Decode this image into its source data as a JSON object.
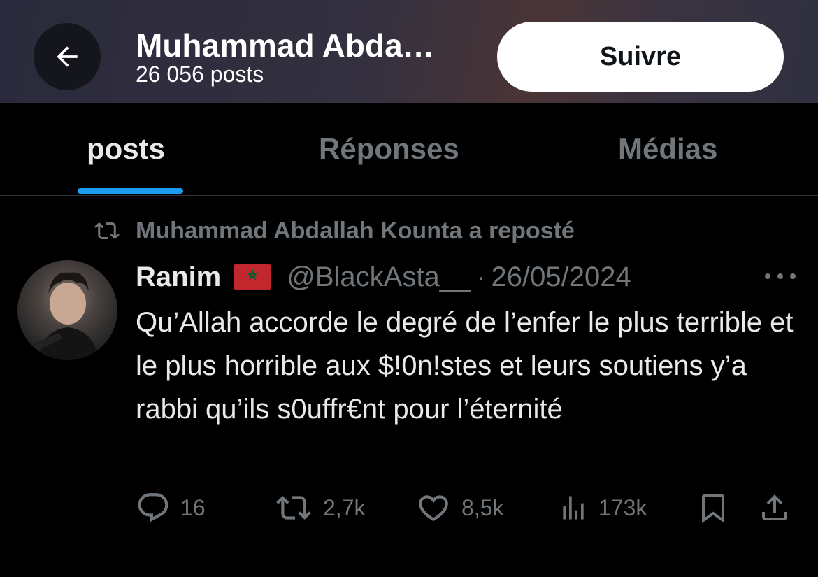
{
  "header": {
    "title": "Muhammad Abda…",
    "post_count": "26 056 posts",
    "follow_label": "Suivre"
  },
  "tabs": [
    {
      "label": "posts"
    },
    {
      "label": "Réponses"
    },
    {
      "label": "Médias"
    }
  ],
  "tweet": {
    "repost_text": "Muhammad Abdallah Kounta a reposté",
    "author_name": "Ranim",
    "handle": "@BlackAsta__",
    "separator": "·",
    "date": "26/05/2024",
    "text": "Qu’Allah accorde le degré de l’enfer le plus terrible et le plus horrible aux $!0n!stes et leurs soutiens y’a rabbi qu’ils s0uffr€nt pour l’éternité",
    "stats": {
      "replies": "16",
      "reposts": "2,7k",
      "likes": "8,5k",
      "views": "173k"
    }
  },
  "colors": {
    "accent": "#1d9bf0",
    "muted": "#71767b",
    "text": "#e7e9ea",
    "background": "#000000"
  }
}
